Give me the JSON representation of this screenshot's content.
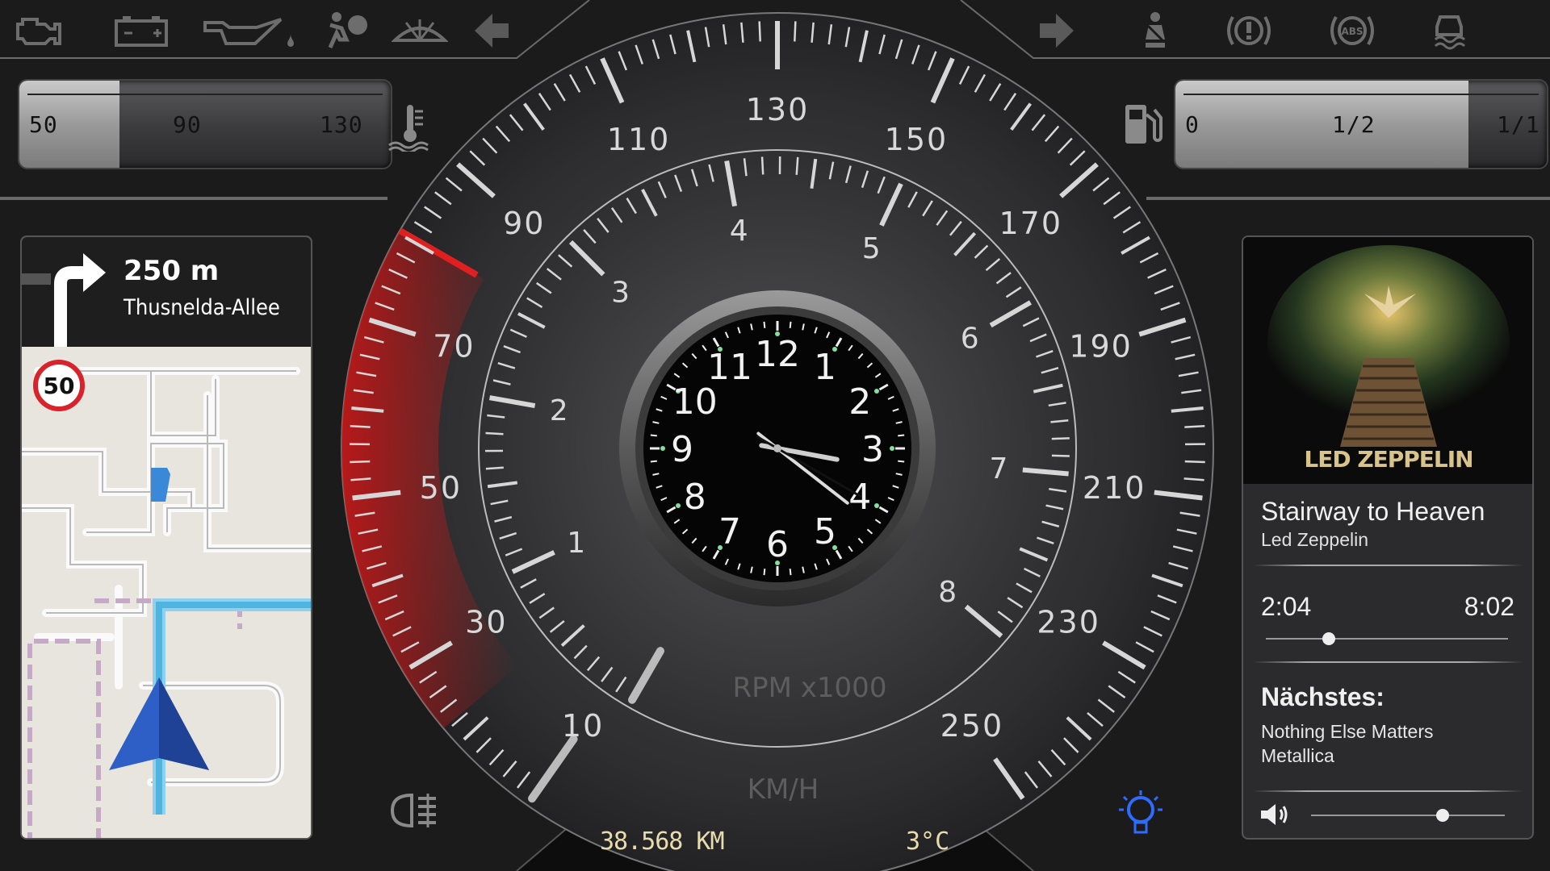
{
  "top_indicators_left": [
    "engine-icon",
    "battery-icon",
    "oil-can-icon",
    "airbag-icon",
    "washer-icon",
    "left-arrow-icon"
  ],
  "top_indicators_right": [
    "right-arrow-icon",
    "seatbelt-icon",
    "brake-warning-icon",
    "abs-icon",
    "stability-icon"
  ],
  "abs_label": "ABS",
  "temp_gauge": {
    "labels": [
      "50",
      "90",
      "130"
    ],
    "level": 0.27
  },
  "fuel_gauge": {
    "labels": [
      "0",
      "1/2",
      "1/1"
    ],
    "level": 0.79
  },
  "speedometer": {
    "labels": [
      "10",
      "30",
      "50",
      "70",
      "90",
      "110",
      "130",
      "150",
      "170",
      "190",
      "210",
      "230",
      "250"
    ],
    "unit": "KM/H"
  },
  "tachometer": {
    "labels": [
      "1",
      "2",
      "3",
      "4",
      "5",
      "6",
      "7",
      "8"
    ],
    "unit": "RPM x1000"
  },
  "clock": {
    "numbers": [
      "12",
      "1",
      "2",
      "3",
      "4",
      "5",
      "6",
      "7",
      "8",
      "9",
      "10",
      "11"
    ],
    "hour": 3,
    "minute": 21,
    "second": 20
  },
  "navigation": {
    "distance": "250 m",
    "street": "Thusnelda-Allee",
    "speed_limit": "50"
  },
  "music": {
    "title": "Stairway to Heaven",
    "artist": "Led Zeppelin",
    "cover_text": "LED ZEPPELIN",
    "elapsed": "2:04",
    "duration": "8:02",
    "progress": 0.26,
    "next_label": "Nächstes:",
    "next_title": "Nothing Else Matters",
    "next_artist": "Metallica",
    "volume": 0.68
  },
  "bottom": {
    "odometer": "38.568 KM",
    "outside_temp": "3°C"
  },
  "colors": {
    "redline": "#d01818",
    "display_text": "#e8dcae",
    "route": "#4fb4e0",
    "nav_arrow": "#2d5fc6",
    "lamp_blue": "#2f6bff"
  }
}
